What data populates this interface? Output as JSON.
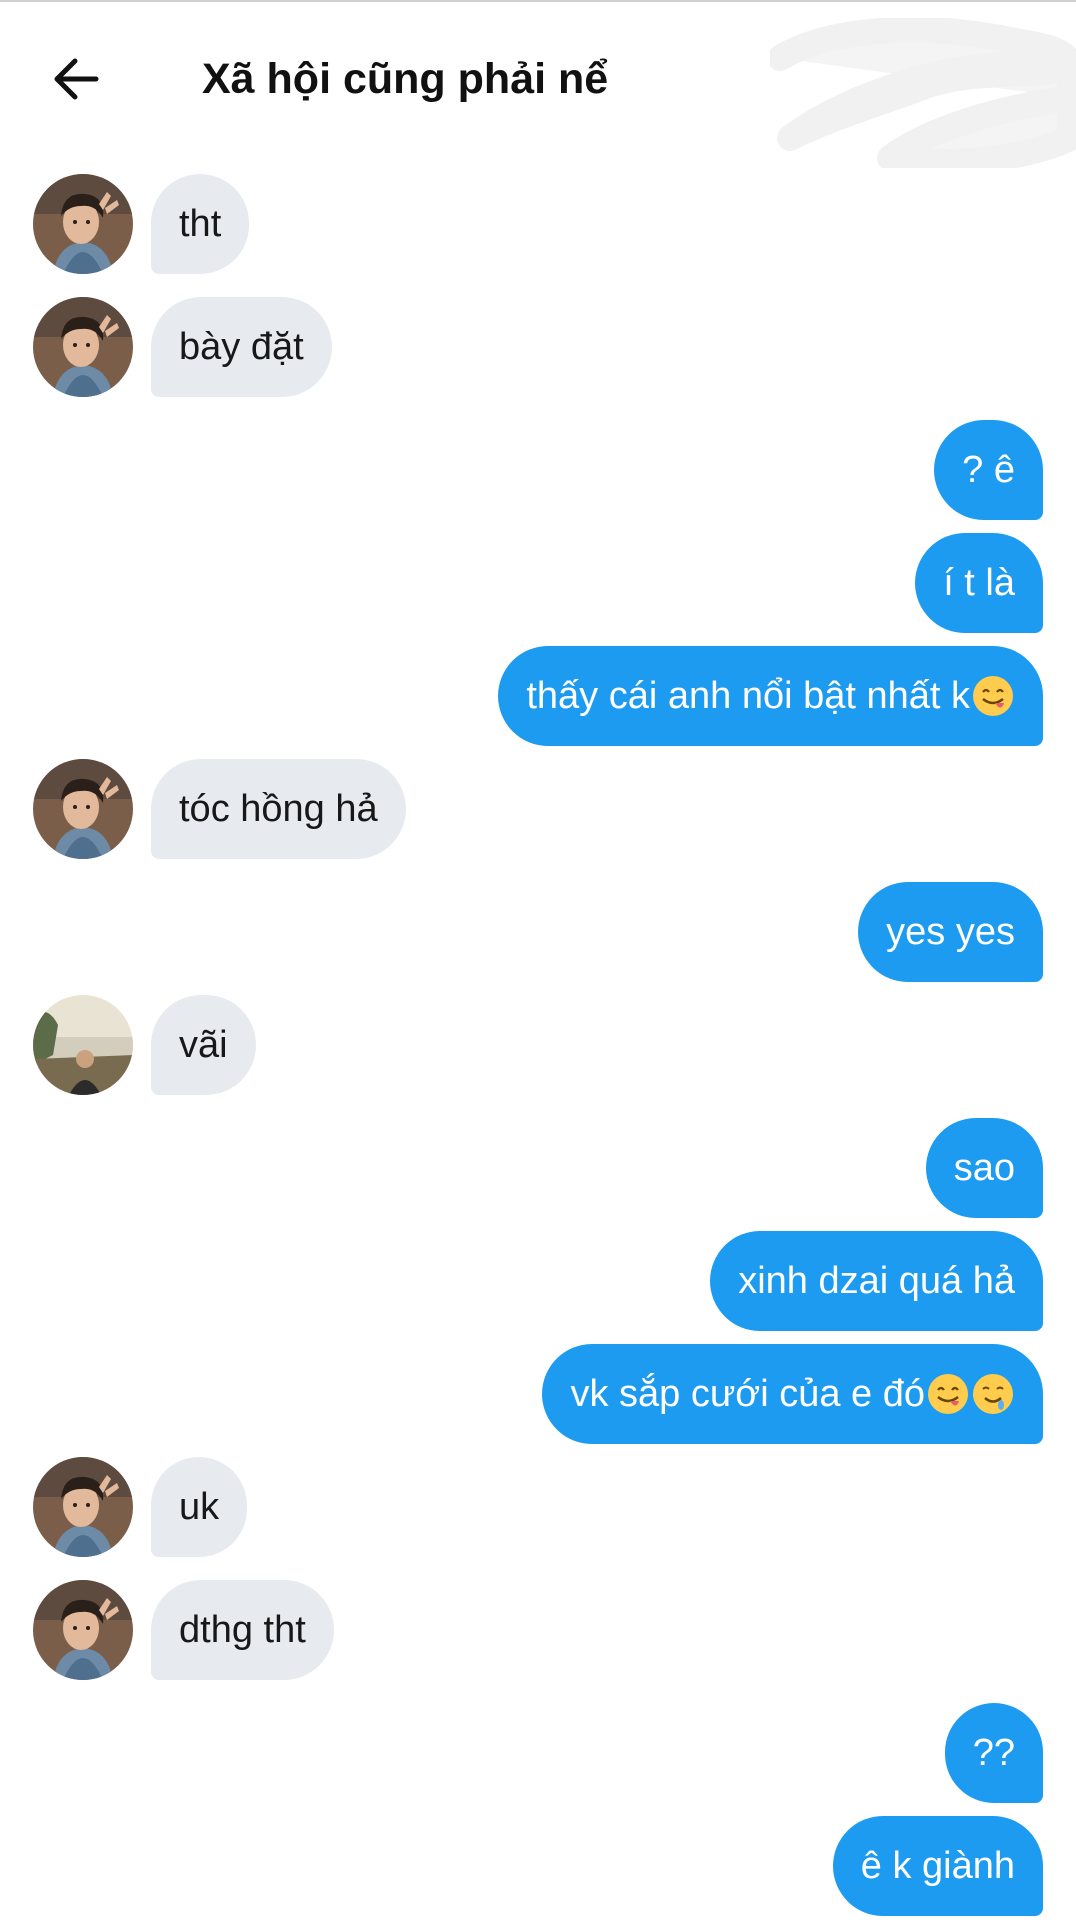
{
  "header": {
    "title": "Xã hội cũng phải nể",
    "back_icon": "arrow-left-icon"
  },
  "colors": {
    "outgoing_bubble": "#1d9bf0",
    "incoming_bubble": "#e7ebef",
    "background": "#ffffff"
  },
  "messages": [
    {
      "dir": "in",
      "text": "tht",
      "avatar": "avatar-boy"
    },
    {
      "dir": "in",
      "text": "bày đặt",
      "avatar": "avatar-boy"
    },
    {
      "dir": "out",
      "text": "? ê"
    },
    {
      "dir": "out",
      "text": "í t là"
    },
    {
      "dir": "out",
      "text": "thấy cái anh nổi bật nhất k",
      "emoji": [
        "face-savoring-food-icon"
      ]
    },
    {
      "dir": "in",
      "text": "tóc hồng hả",
      "avatar": "avatar-boy"
    },
    {
      "dir": "out",
      "text": "yes yes"
    },
    {
      "dir": "in",
      "text": "vãi",
      "avatar": "avatar-lake"
    },
    {
      "dir": "out",
      "text": "sao"
    },
    {
      "dir": "out",
      "text": "xinh dzai quá hả"
    },
    {
      "dir": "out",
      "text": "vk sắp cưới của e đó",
      "emoji": [
        "face-savoring-food-icon",
        "drooling-face-icon"
      ]
    },
    {
      "dir": "in",
      "text": "uk",
      "avatar": "avatar-boy"
    },
    {
      "dir": "in",
      "text": "dthg tht",
      "avatar": "avatar-boy"
    },
    {
      "dir": "out",
      "text": "??"
    },
    {
      "dir": "out",
      "text": "ê k giành"
    }
  ]
}
